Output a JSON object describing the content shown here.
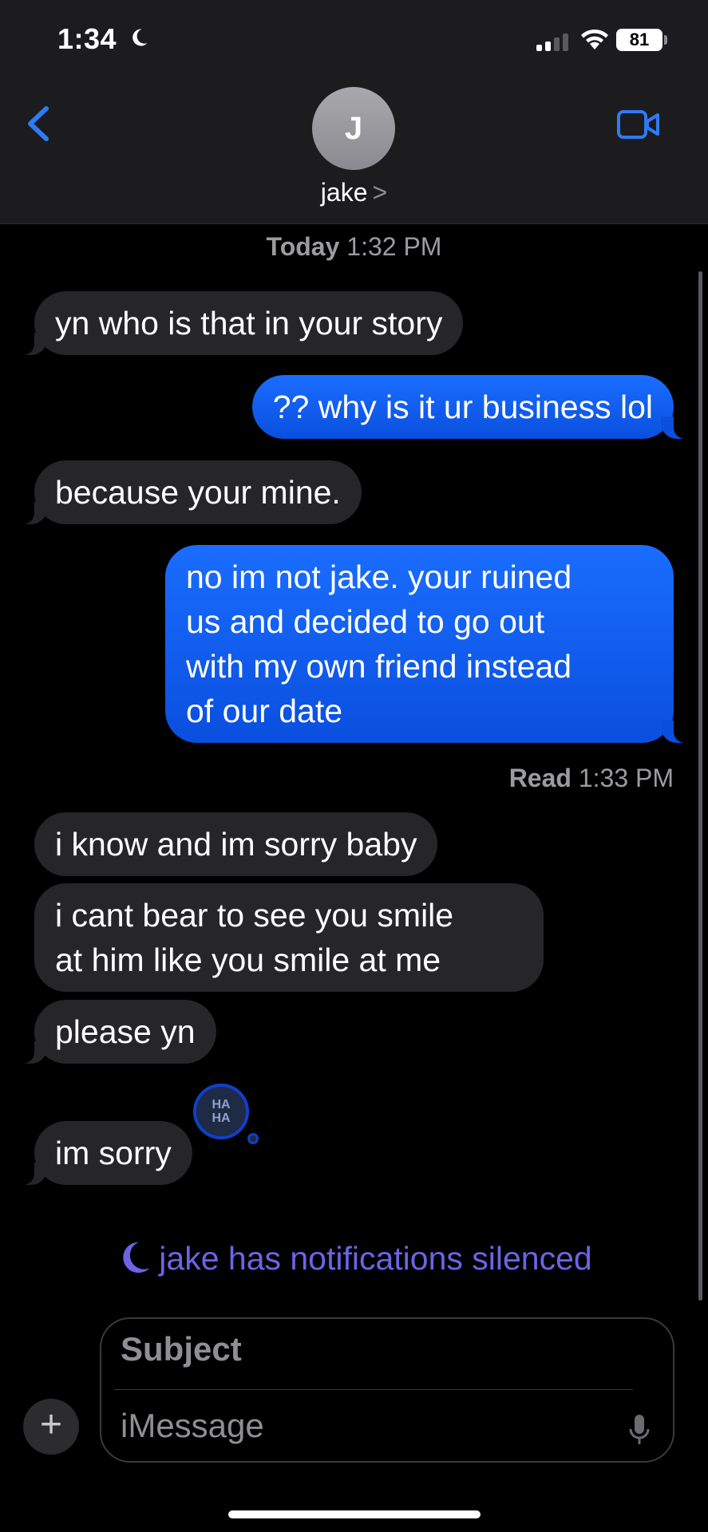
{
  "status_bar": {
    "time": "1:34",
    "battery": "81"
  },
  "header": {
    "avatar_initial": "J",
    "contact_name": "jake",
    "chevron": ">"
  },
  "timestamp": {
    "day": "Today",
    "time": "1:32 PM"
  },
  "messages": [
    {
      "from": "them",
      "text": "yn who is that in your story"
    },
    {
      "from": "me",
      "text": "?? why is it ur business lol"
    },
    {
      "from": "them",
      "text": "because your mine."
    },
    {
      "from": "me",
      "lines": [
        "no im not jake. your ruined",
        "us and decided to go out",
        "with my own friend instead",
        "of our date"
      ]
    },
    {
      "from": "them",
      "text": "i know and im sorry baby"
    },
    {
      "from": "them",
      "lines": [
        "i cant bear to see you smile",
        "at him like you smile at me"
      ]
    },
    {
      "from": "them",
      "text": "please yn"
    },
    {
      "from": "them",
      "text": "im sorry"
    }
  ],
  "read_receipt": {
    "label": "Read",
    "time": "1:33 PM"
  },
  "tapback": {
    "text_line1": "HA",
    "text_line2": "HA"
  },
  "silenced_notice": {
    "text": "jake has notifications silenced",
    "color": "#6b65e6"
  },
  "composer": {
    "subject_placeholder": "Subject",
    "message_placeholder": "iMessage",
    "plus": "+"
  },
  "colors": {
    "outgoing_bubble": "#0a5cff",
    "incoming_bubble": "#262628",
    "accent": "#2f7bf5"
  },
  "icons": [
    "moon-icon",
    "signal-icon",
    "wifi-icon",
    "battery-icon",
    "back-chevron-icon",
    "video-camera-icon",
    "moon-icon",
    "plus-icon",
    "microphone-icon"
  ]
}
